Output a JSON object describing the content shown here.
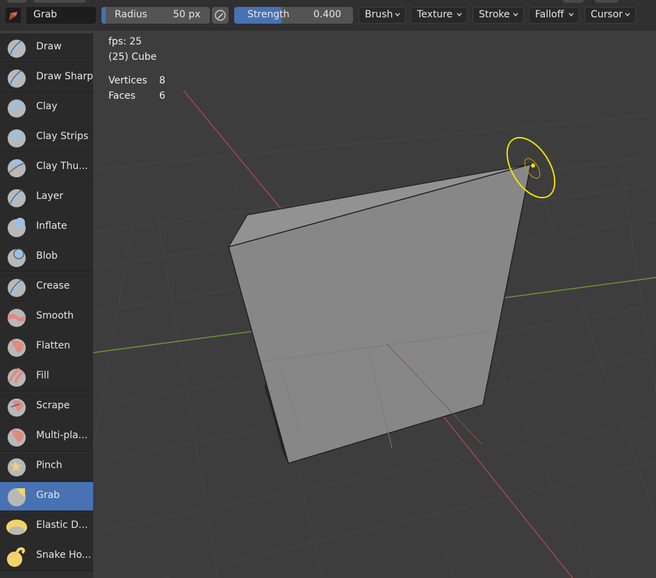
{
  "header": {
    "brush_name": "Grab",
    "radius": {
      "label": "Radius",
      "value": "50 px",
      "fraction": 0.04
    },
    "strength": {
      "label": "Strength",
      "value": "0.400",
      "fraction": 0.4
    },
    "menus": [
      "Brush",
      "Texture",
      "Stroke",
      "Falloff",
      "Cursor"
    ]
  },
  "sidebar": {
    "active": "Grab",
    "tools": [
      {
        "label": "Draw",
        "icon": "draw-brush-icon",
        "color": "#9cc1e3"
      },
      {
        "label": "Draw Sharp",
        "icon": "draw-sharp-brush-icon",
        "color": "#9cc1e3"
      },
      {
        "label": "Clay",
        "icon": "clay-brush-icon",
        "color": "#9cc1e3"
      },
      {
        "label": "Clay Strips",
        "icon": "clay-strips-brush-icon",
        "color": "#9cc1e3"
      },
      {
        "label": "Clay Thu...",
        "icon": "clay-thumb-brush-icon",
        "color": "#9cc1e3"
      },
      {
        "label": "Layer",
        "icon": "layer-brush-icon",
        "color": "#9cc1e3"
      },
      {
        "label": "Inflate",
        "icon": "inflate-brush-icon",
        "color": "#9cc1e3"
      },
      {
        "label": "Blob",
        "icon": "blob-brush-icon",
        "color": "#9cc1e3"
      },
      {
        "label": "Crease",
        "icon": "crease-brush-icon",
        "color": "#9cc1e3"
      },
      {
        "label": "Smooth",
        "icon": "smooth-brush-icon",
        "color": "#e08a80"
      },
      {
        "label": "Flatten",
        "icon": "flatten-brush-icon",
        "color": "#e08a80"
      },
      {
        "label": "Fill",
        "icon": "fill-brush-icon",
        "color": "#e08a80"
      },
      {
        "label": "Scrape",
        "icon": "scrape-brush-icon",
        "color": "#e08a80"
      },
      {
        "label": "Multi-pla...",
        "icon": "multiplane-scrape-brush-icon",
        "color": "#e08a80"
      },
      {
        "label": "Pinch",
        "icon": "pinch-brush-icon",
        "color": "#f2d36b"
      },
      {
        "label": "Grab",
        "icon": "grab-brush-icon",
        "color": "#f2d36b"
      },
      {
        "label": "Elastic D...",
        "icon": "elastic-deform-brush-icon",
        "color": "#f2d36b"
      },
      {
        "label": "Snake Ho...",
        "icon": "snake-hook-brush-icon",
        "color": "#f2d36b"
      }
    ]
  },
  "viewport": {
    "fps": "fps: 25",
    "object": "(25) Cube",
    "stats": [
      {
        "label": "Vertices",
        "value": "8"
      },
      {
        "label": "Faces",
        "value": "6"
      }
    ],
    "colors": {
      "x_axis": "#b0454f",
      "y_axis": "#6b9a2f",
      "cursor": "#f2e000",
      "mesh": "#888888"
    }
  }
}
